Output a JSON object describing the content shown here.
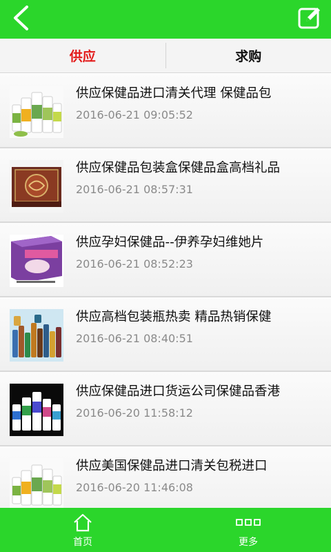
{
  "header": {
    "back_icon": "chevron-left-icon",
    "edit_icon": "edit-icon",
    "color": "#2bd62b"
  },
  "tabs": [
    {
      "label": "供应",
      "active": true
    },
    {
      "label": "求购",
      "active": false
    }
  ],
  "items": [
    {
      "title": "供应保健品进口清关代理 保健品包",
      "date": "2016-06-21 09:05:52",
      "thumb": "supplement-bottles"
    },
    {
      "title": "供应保健品包装盒保健品盒高档礼品",
      "date": "2016-06-21 08:57:31",
      "thumb": "wooden-gift-box"
    },
    {
      "title": "供应孕妇保健品--伊养孕妇维她片",
      "date": "2016-06-21 08:52:23",
      "thumb": "purple-vitamin-box"
    },
    {
      "title": "供应高档包装瓶热卖 精品热销保健",
      "date": "2016-06-21 08:40:51",
      "thumb": "small-glass-bottles"
    },
    {
      "title": "供应保健品进口货运公司保健品香港",
      "date": "2016-06-20 11:58:12",
      "thumb": "bottles-dark-bg"
    },
    {
      "title": "供应美国保健品进口清关包税进口",
      "date": "2016-06-20 11:46:08",
      "thumb": "supplement-bottles"
    }
  ],
  "bottom_nav": [
    {
      "label": "首页",
      "icon": "home-icon"
    },
    {
      "label": "更多",
      "icon": "more-icon"
    }
  ],
  "colors": {
    "accent": "#2bd62b",
    "active_tab": "#e31a1a",
    "date_text": "#8a8a8a"
  }
}
